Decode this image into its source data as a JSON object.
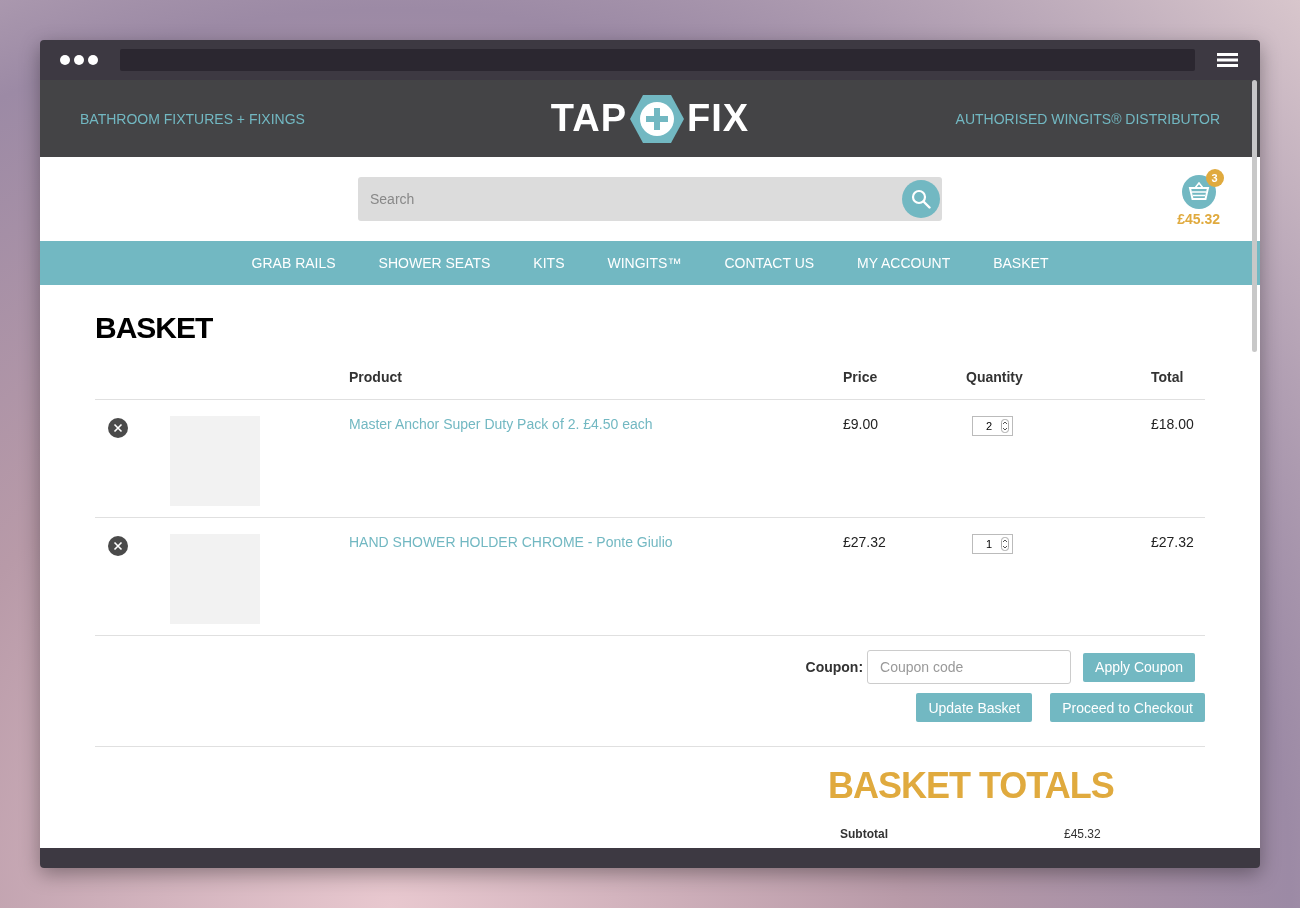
{
  "header": {
    "tagline": "BATHROOM FIXTURES + FIXINGS",
    "logo": {
      "left": "TAP",
      "right": "FIX"
    },
    "distributor": "AUTHORISED WINGITS® DISTRIBUTOR"
  },
  "search": {
    "placeholder": "Search"
  },
  "cart": {
    "count": "3",
    "total": "£45.32"
  },
  "nav": [
    "GRAB RAILS",
    "SHOWER SEATS",
    "KITS",
    "WINGITS™",
    "CONTACT US",
    "MY ACCOUNT",
    "BASKET"
  ],
  "title": "BASKET",
  "table": {
    "columns": [
      "Product",
      "Price",
      "Quantity",
      "Total"
    ],
    "rows": [
      {
        "product": "Master Anchor Super Duty Pack of 2. £4.50 each",
        "price": "£9.00",
        "quantity": "2",
        "total": "£18.00"
      },
      {
        "product": "HAND SHOWER HOLDER CHROME - Ponte Giulio",
        "price": "£27.32",
        "quantity": "1",
        "total": "£27.32"
      }
    ]
  },
  "coupon": {
    "label": "Coupon:",
    "placeholder": "Coupon code",
    "apply": "Apply Coupon"
  },
  "actions": [
    "Update Basket",
    "Proceed to Checkout"
  ],
  "totals": {
    "title": "BASKET TOTALS",
    "rows": [
      {
        "label": "Subtotal",
        "value": "£45.32"
      }
    ]
  }
}
